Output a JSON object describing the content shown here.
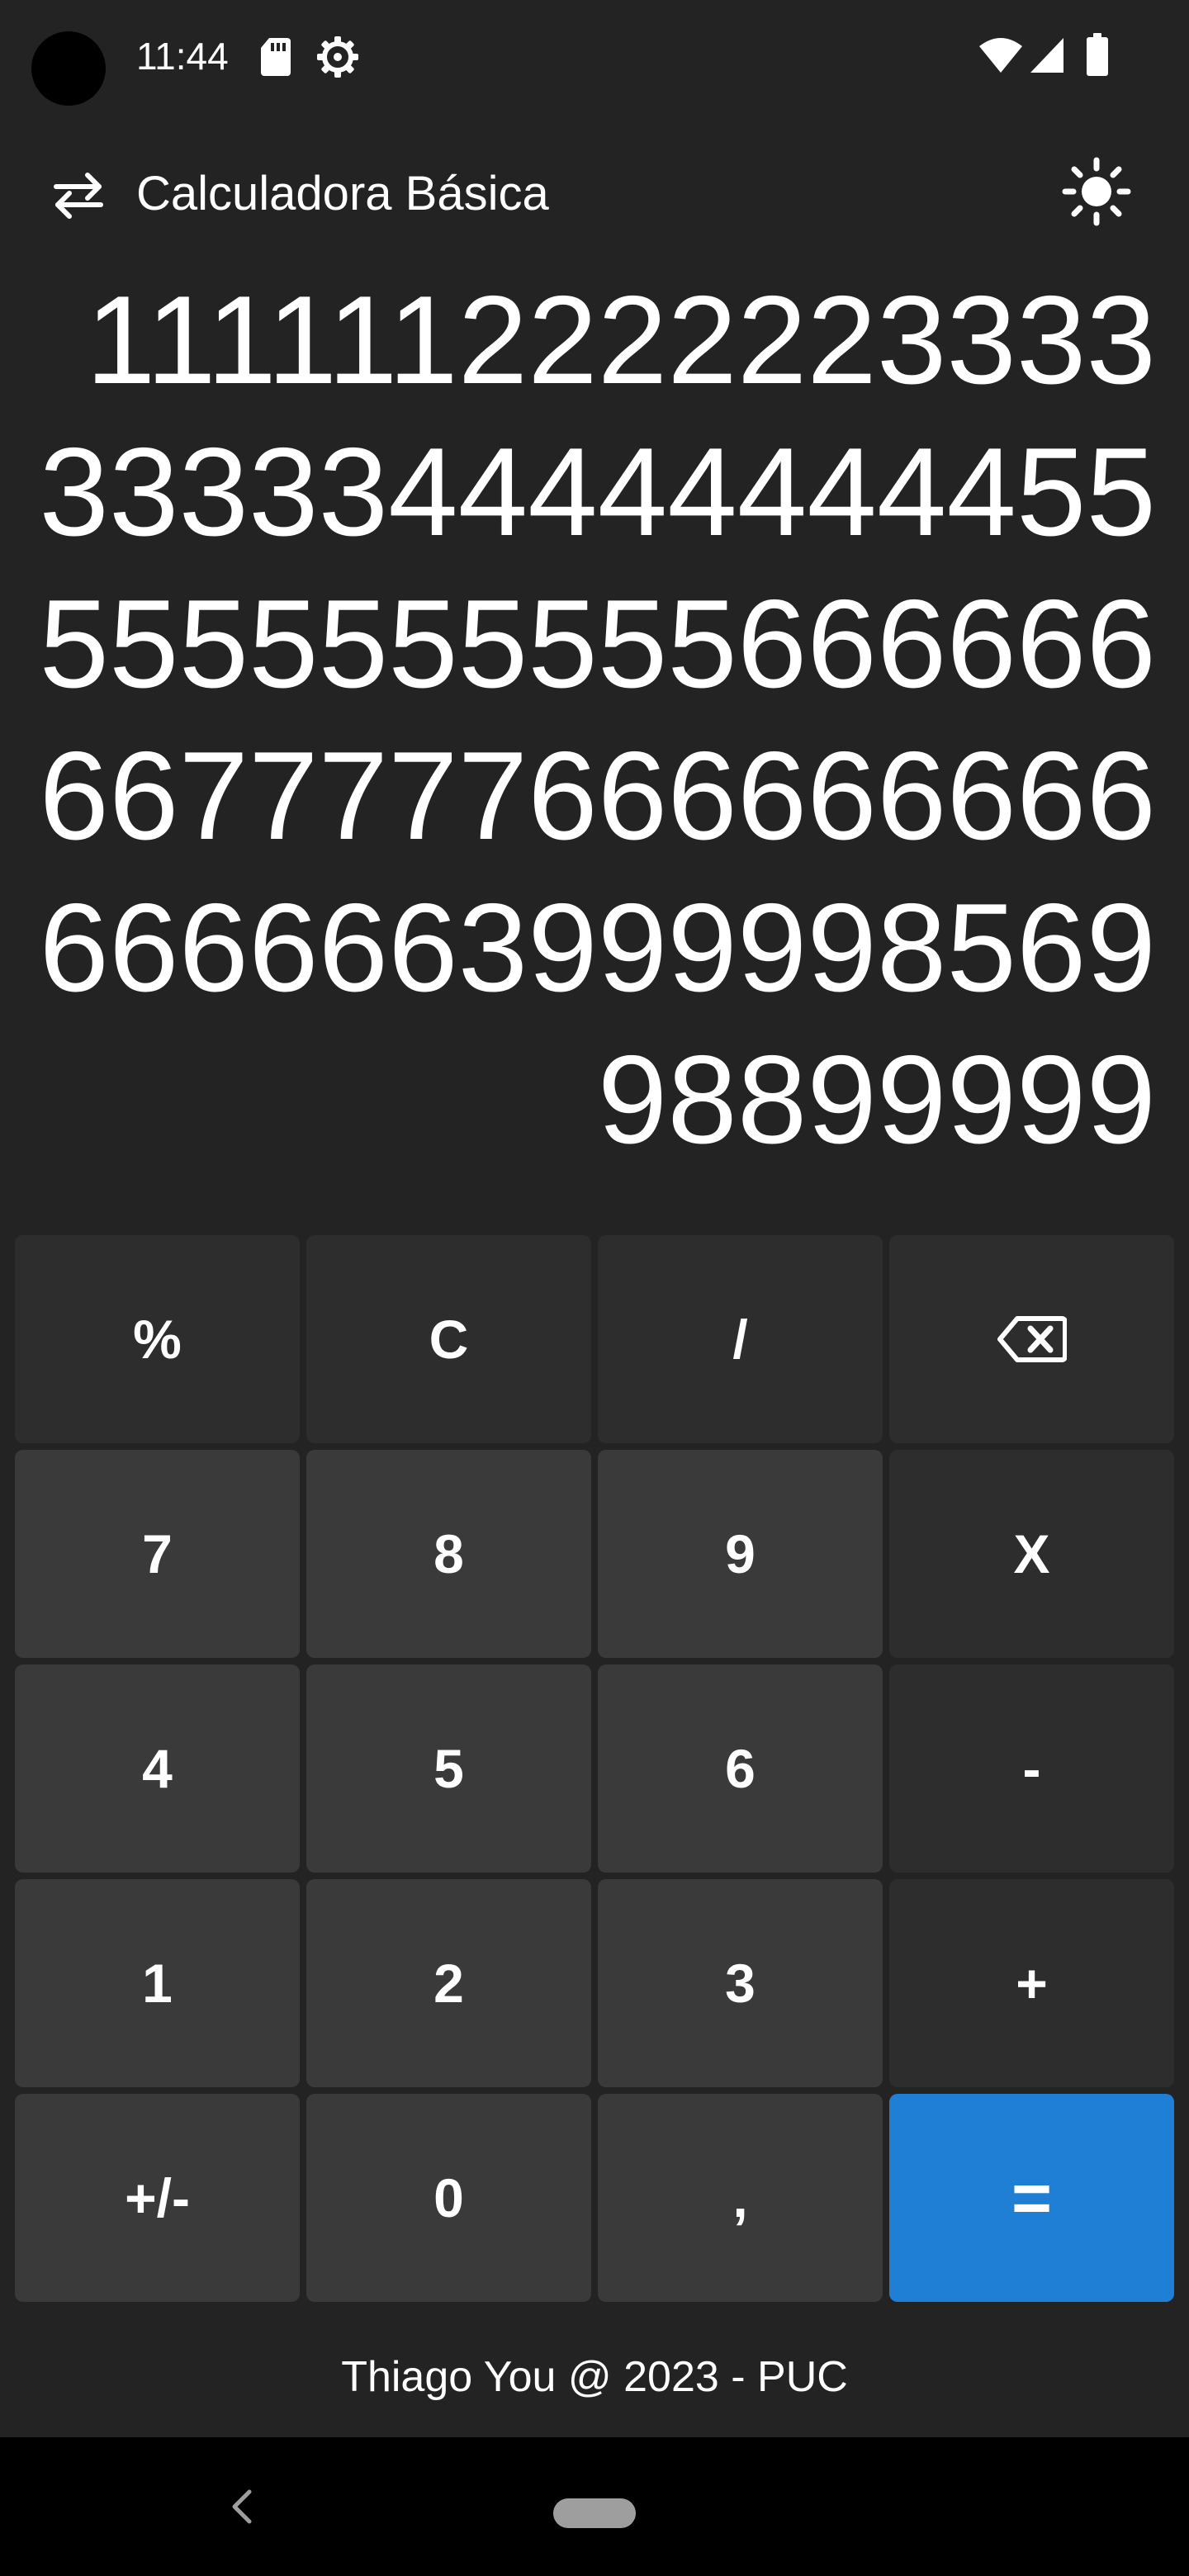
{
  "status_bar": {
    "time": "11:44",
    "icons": [
      "sd-card-icon",
      "settings-gear-icon",
      "wifi-icon",
      "cellular-signal-icon",
      "battery-icon"
    ]
  },
  "app_bar": {
    "title": "Calculadora Básica",
    "left_icon": "swap-icon",
    "right_icon": "brightness-icon"
  },
  "display": {
    "value": "1111112222223333333334444444445555555555556666666677777666666666666666399999856998899999"
  },
  "keypad": {
    "rows": [
      [
        {
          "label": "%",
          "name": "percent-key",
          "style": "op"
        },
        {
          "label": "C",
          "name": "clear-key",
          "style": "op"
        },
        {
          "label": "/",
          "name": "divide-key",
          "style": "op"
        },
        {
          "label": "",
          "name": "backspace-key",
          "style": "op",
          "icon": "backspace-icon"
        }
      ],
      [
        {
          "label": "7",
          "name": "digit-7-key",
          "style": "num"
        },
        {
          "label": "8",
          "name": "digit-8-key",
          "style": "num"
        },
        {
          "label": "9",
          "name": "digit-9-key",
          "style": "num"
        },
        {
          "label": "X",
          "name": "multiply-key",
          "style": "op"
        }
      ],
      [
        {
          "label": "4",
          "name": "digit-4-key",
          "style": "num"
        },
        {
          "label": "5",
          "name": "digit-5-key",
          "style": "num"
        },
        {
          "label": "6",
          "name": "digit-6-key",
          "style": "num"
        },
        {
          "label": "-",
          "name": "subtract-key",
          "style": "op"
        }
      ],
      [
        {
          "label": "1",
          "name": "digit-1-key",
          "style": "num"
        },
        {
          "label": "2",
          "name": "digit-2-key",
          "style": "num"
        },
        {
          "label": "3",
          "name": "digit-3-key",
          "style": "num"
        },
        {
          "label": "+",
          "name": "add-key",
          "style": "op"
        }
      ],
      [
        {
          "label": "+/-",
          "name": "toggle-sign-key",
          "style": "num"
        },
        {
          "label": "0",
          "name": "digit-0-key",
          "style": "num"
        },
        {
          "label": ",",
          "name": "decimal-comma-key",
          "style": "num"
        },
        {
          "label": "=",
          "name": "equals-key",
          "style": "equals"
        }
      ]
    ]
  },
  "footer": {
    "text": "Thiago You @ 2023 - PUC"
  },
  "nav_bar": {
    "icons": [
      "back-icon",
      "home-pill-icon"
    ]
  },
  "colors": {
    "background": "#232323",
    "number_key": "#3a3a3a",
    "operator_key": "#2d2d2d",
    "equals_key": "#1e7fd4",
    "text": "#ffffff",
    "nav_bar": "#000000"
  }
}
